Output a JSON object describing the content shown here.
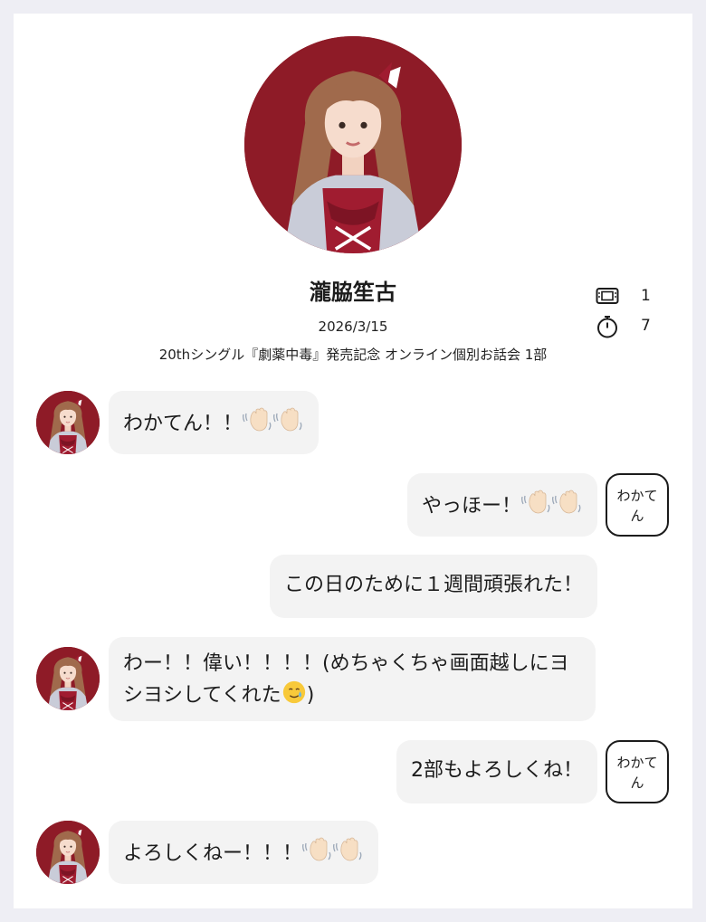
{
  "profile": {
    "name": "瀧脇笙古",
    "date": "2026/3/15",
    "event": "20thシングル『劇薬中毒』発売記念 オンライン個別お話会 1部"
  },
  "stats": {
    "tickets": "1",
    "minutes": "7"
  },
  "messages": [
    {
      "from": "member",
      "text": "わかてん！！"
    },
    {
      "from": "fan",
      "text": "やっほー！",
      "tag": "わかてん"
    },
    {
      "from": "fan",
      "text": "この日のために１週間頑張れた！"
    },
    {
      "from": "member",
      "text": "わー！！偉い！！！！(めちゃくちゃ画面越しにヨシヨシしてくれた",
      "text_end": ")"
    },
    {
      "from": "fan",
      "text": "2部もよろしくね！",
      "tag": "わかてん"
    },
    {
      "from": "member",
      "text": "よろしくねー！！！"
    }
  ],
  "icons": {
    "tickets": "ticket-icon",
    "minutes": "stopwatch-icon",
    "wave": "waving-hand-emoji",
    "tear": "smiling-face-with-tear-emoji"
  },
  "colors": {
    "background": "#eeeef4",
    "bubble": "#f3f3f3",
    "avatar_background": "#8e1b27"
  }
}
